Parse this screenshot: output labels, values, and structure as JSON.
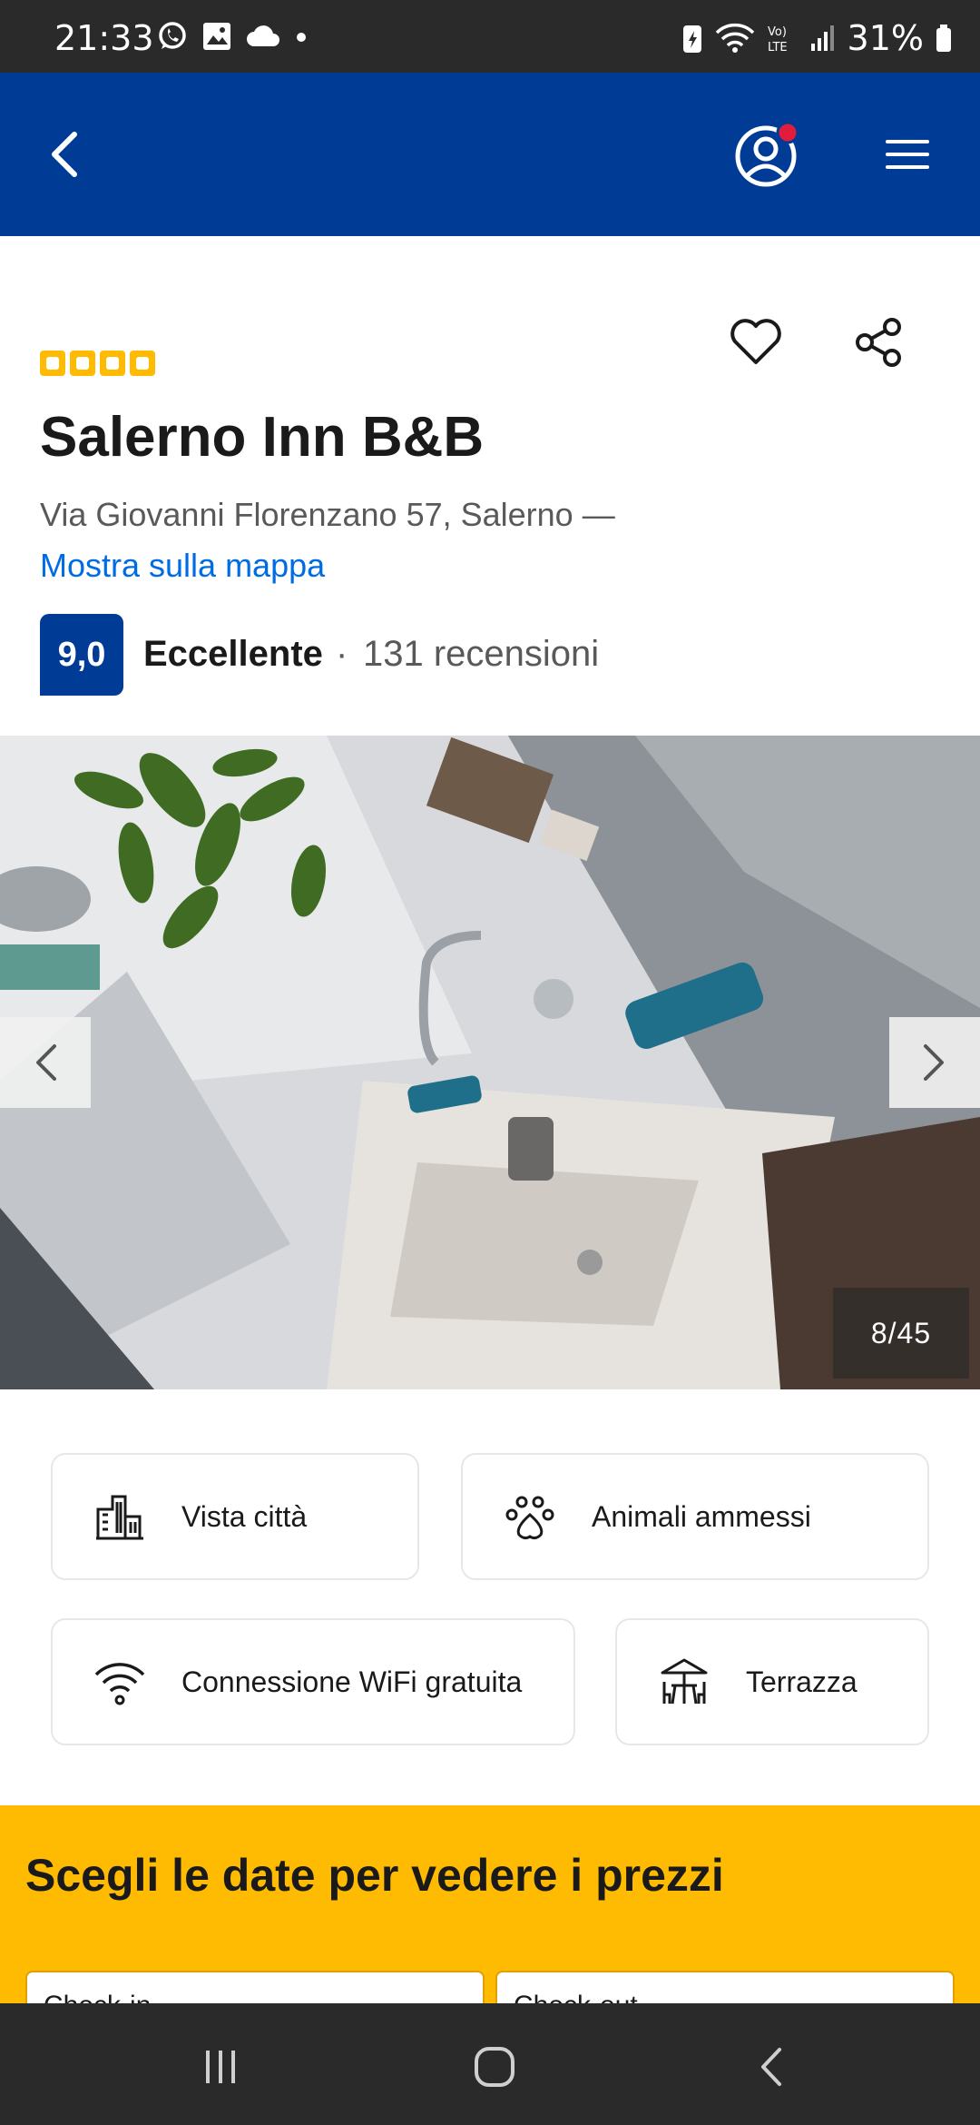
{
  "status_bar": {
    "time": "21:33",
    "battery": "31%",
    "icons": [
      "whatsapp-icon",
      "gallery-icon",
      "cloud-icon",
      "dot-icon",
      "battery-saver-icon",
      "wifi-icon",
      "volte-icon",
      "signal-icon",
      "battery-icon"
    ]
  },
  "header": {
    "icons": [
      "back-arrow-icon",
      "account-icon",
      "hamburger-menu-icon"
    ],
    "brand_color": "#003b95",
    "notification_color": "#e21c3c"
  },
  "property": {
    "star_rating": 4,
    "name": "Salerno Inn B&B",
    "address": "Via Giovanni Florenzano 57, Salerno —",
    "map_link": "Mostra sulla mappa",
    "score": "9,0",
    "score_label": "Eccellente",
    "separator": "·",
    "reviews": "131 recensioni",
    "icons": [
      "heart-icon",
      "share-icon"
    ]
  },
  "gallery": {
    "counter": "8/45",
    "icons": [
      "chevron-left-icon",
      "chevron-right-icon"
    ]
  },
  "amenities": [
    {
      "label": "Vista città",
      "icon": "city-view-icon"
    },
    {
      "label": "Animali ammessi",
      "icon": "paw-icon"
    },
    {
      "label": "Connessione WiFi gratuita",
      "icon": "wifi-icon"
    },
    {
      "label": "Terrazza",
      "icon": "terrace-icon"
    }
  ],
  "dates": {
    "title": "Scegli le date per vedere i prezzi",
    "check_in": "Check-in",
    "check_out": "Check-out",
    "accent_color": "#febb02"
  },
  "nav_bar": {
    "icons": [
      "recent-apps-icon",
      "home-icon",
      "back-icon"
    ]
  }
}
